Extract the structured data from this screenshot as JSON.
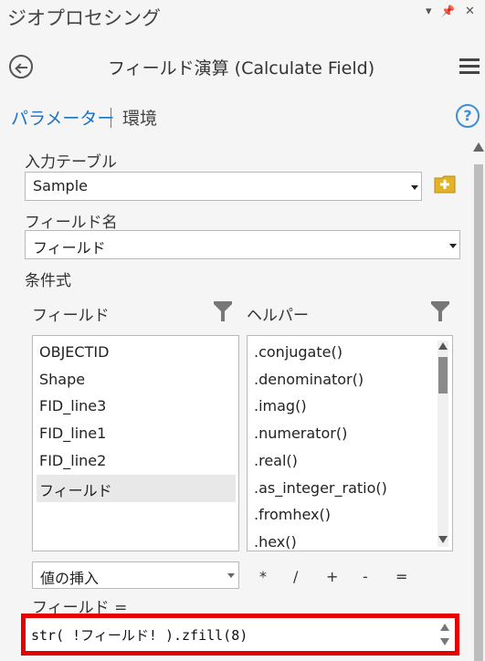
{
  "pane": {
    "title": "ジオプロセシング",
    "controls": [
      "▾",
      "📌",
      "✕"
    ]
  },
  "tool": {
    "title": "フィールド演算 (Calculate Field)"
  },
  "tabs": {
    "active": "パラメーター",
    "inactive": "環境"
  },
  "params": {
    "input_table": {
      "label": "入力テーブル",
      "value": "Sample"
    },
    "field_name": {
      "label": "フィールド名",
      "value": "フィールド"
    },
    "condition_label": "条件式",
    "fields_header": "フィールド",
    "helpers_header": "ヘルパー",
    "fields": [
      "OBJECTID",
      "Shape",
      "FID_line3",
      "FID_line1",
      "FID_line2",
      "フィールド"
    ],
    "selected_field": "フィールド",
    "helpers": [
      ".conjugate()",
      ".denominator()",
      ".imag()",
      ".numerator()",
      ".real()",
      ".as_integer_ratio()",
      ".fromhex()",
      ".hex()"
    ],
    "insert_value": "値の挿入",
    "operators": [
      "*",
      "/",
      "+",
      "-",
      "="
    ],
    "expression_label": "フィールド =",
    "expression": "str( !フィールド! ).zfill(8)"
  },
  "colors": {
    "accent": "#1a73c2",
    "highlight": "#e60000",
    "folder": "#e2b227"
  }
}
